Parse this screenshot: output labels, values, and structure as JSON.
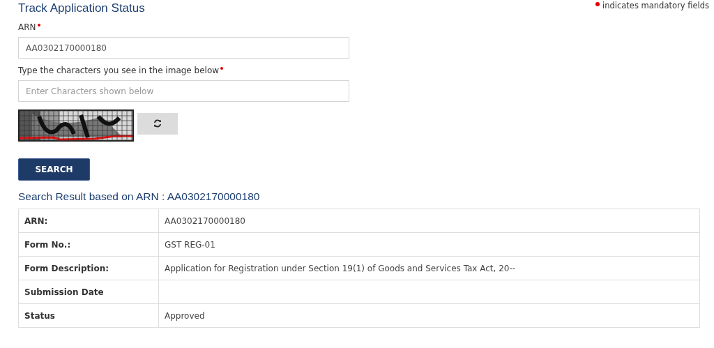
{
  "title": "Track Application Status",
  "mandatory_note": "indicates mandatory fields",
  "fields": [
    {
      "label": "ARN",
      "required": true,
      "value": "AA0302170000180"
    },
    {
      "label": "Type the characters you see in the image below",
      "required": true,
      "placeholder": "Enter Characters shown below"
    }
  ],
  "search_button": "SEARCH",
  "result_heading": "Search Result based on ARN : AA0302170000180",
  "result_rows": [
    {
      "label": "ARN:",
      "value": "AA0302170000180"
    },
    {
      "label": "Form No.:",
      "value": "GST REG-01"
    },
    {
      "label": "Form Description:",
      "value": "Application for Registration under Section 19(1) of Goods and Services Tax Act, 20--"
    },
    {
      "label": "Submission Date"
    },
    {
      "label": "Status",
      "value": "Approved"
    }
  ]
}
